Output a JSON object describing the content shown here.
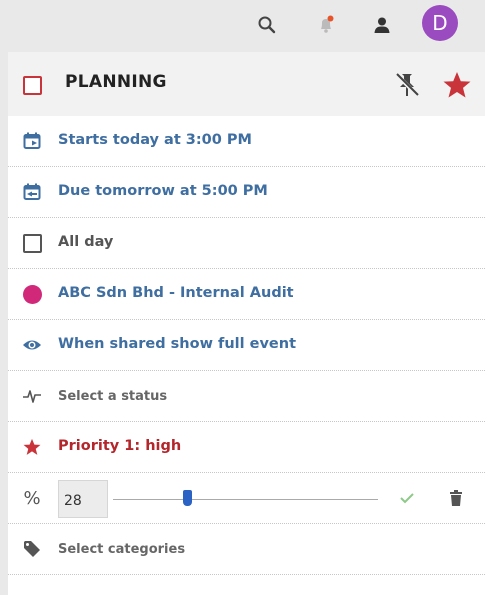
{
  "topbar": {
    "icons": [
      "search-icon",
      "notifications-icon",
      "user-icon"
    ],
    "avatar_letter": "D",
    "avatar_color": "#9b4bc0",
    "notification_dot_color": "#e8542a"
  },
  "task": {
    "title": "PLANNING",
    "starts": "Starts today at 3:00 PM",
    "due": "Due tomorrow at 5:00 PM",
    "all_day": "All day",
    "calendar": "ABC Sdn Bhd - Internal Audit",
    "calendar_color": "#d1287a",
    "visibility": "When shared show full event",
    "status_placeholder": "Select a status",
    "priority": "Priority 1: high",
    "percent_symbol": "%",
    "percent_value": "28",
    "progress": 0.28,
    "categories_placeholder": "Select categories"
  },
  "colors": {
    "accent_blue": "#3f6ea1",
    "priority_red": "#c8343a",
    "confirm_green": "#8fc98a"
  }
}
